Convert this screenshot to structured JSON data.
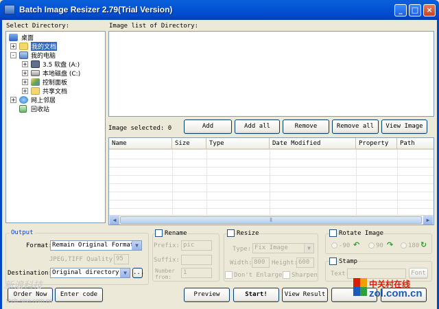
{
  "window": {
    "title": "Batch Image Resizer 2.79(Trial Version)",
    "controls": {
      "minimize": "_",
      "maximize": "□",
      "close": "×"
    }
  },
  "directory": {
    "label": "Select Directory:",
    "tree": [
      {
        "label": "桌面",
        "icon": "desktop-icon"
      },
      {
        "label": "我的文档",
        "icon": "folder-icon",
        "selected": true
      },
      {
        "label": "我的电脑",
        "icon": "computer-icon"
      },
      {
        "label": "3.5 软盘 (A:)",
        "icon": "floppy-icon"
      },
      {
        "label": "本地磁盘 (C:)",
        "icon": "drive-icon"
      },
      {
        "label": "控制面板",
        "icon": "control-panel-icon"
      },
      {
        "label": "共享文档",
        "icon": "folder-icon"
      },
      {
        "label": "网上邻居",
        "icon": "network-icon"
      },
      {
        "label": "回收站",
        "icon": "recycle-bin-icon"
      }
    ],
    "expanders": [
      "+",
      "-",
      "+",
      "+",
      "+",
      "+",
      "+"
    ]
  },
  "image_list": {
    "label": "Image list of Directory:"
  },
  "selection": {
    "label": "Image selected: 0",
    "buttons": {
      "add": "Add",
      "add_all": "Add all",
      "remove": "Remove",
      "remove_all": "Remove all",
      "view_image": "View Image"
    }
  },
  "table": {
    "columns": [
      "Name",
      "Size",
      "Type",
      "Date Modified",
      "Property",
      "Path"
    ],
    "scroll_thumb": "⦀"
  },
  "output": {
    "legend": "Output",
    "format_label": "Format:",
    "format_value": "Remain Original Format",
    "quality_label": "JPEG,TIFF Quality:",
    "quality_value": "95",
    "destination_label": "Destination:",
    "destination_value": "Original directory",
    "browse": "..."
  },
  "rename": {
    "label": "Rename",
    "prefix_label": "Prefix:",
    "prefix_value": "pic",
    "suffix_label": "Suffix:",
    "number_from_label": "Number from:",
    "number_from_value": "1"
  },
  "resize": {
    "label": "Resize",
    "type_label": "Type:",
    "type_value": "Fix Image",
    "width_label": "Width:",
    "width_value": "800",
    "height_label": "Height:",
    "height_value": "600",
    "dont_enlarge": "Don't Enlarge",
    "sharpen": "Sharpen"
  },
  "rotate": {
    "label": "Rotate Image",
    "options": [
      "-90",
      "90",
      "180"
    ]
  },
  "stamp": {
    "label": "Stamp",
    "text_label": "Text:",
    "font_button": "Font"
  },
  "footer": {
    "order_now": "Order Now",
    "enter_code": "Enter code",
    "preview": "Preview",
    "start": "Start!",
    "view_result": "View Result"
  },
  "watermarks": {
    "left_brand": "新浪科技",
    "left_site": "tech.sina.com.cn",
    "right_brand": "中关村在线",
    "right_site": "zol.com.cn"
  },
  "colors": {
    "title_blue": "#0047c8",
    "selection_blue": "#316ac5",
    "rotate_green": "#2e9e2e",
    "zol_red": "#d81e06",
    "zol_blue": "#1a5bb8"
  }
}
